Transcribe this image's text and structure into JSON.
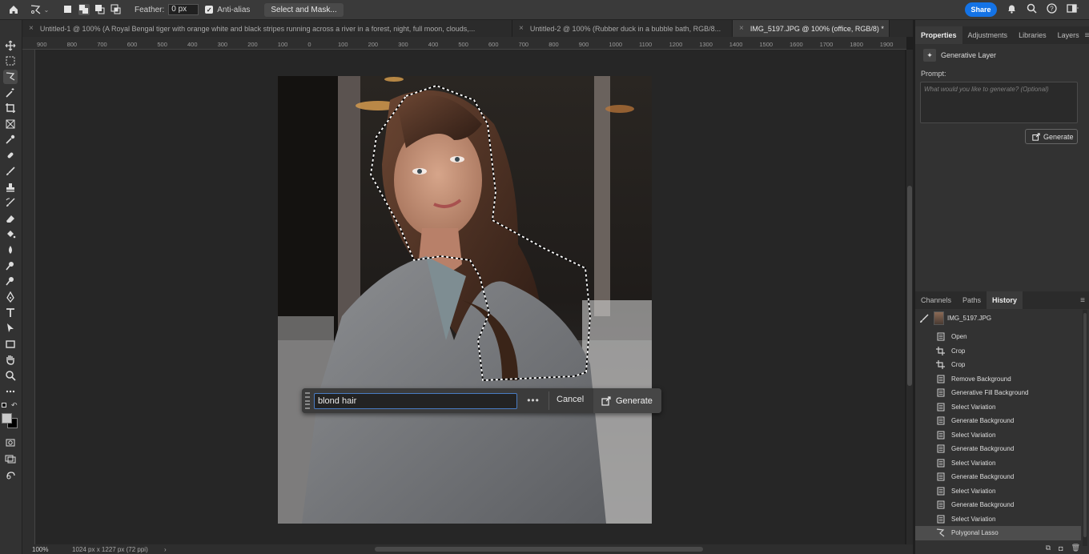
{
  "options": {
    "feather_label": "Feather:",
    "feather_value": "0 px",
    "antialias_label": "Anti-alias",
    "antialias_checked": true,
    "select_mask_label": "Select and Mask...",
    "share_label": "Share"
  },
  "tabs": [
    {
      "label": "Untitled-1 @ 100% (A Royal Bengal tiger with orange white and black stripes running across a river in a forest, night, full moon, clouds,...",
      "active": false
    },
    {
      "label": "Untitled-2 @ 100% (Rubber duck in a bubble bath, RGB/8...",
      "active": false
    },
    {
      "label": "IMG_5197.JPG @ 100% (office, RGB/8) *",
      "active": true
    }
  ],
  "ruler_top": [
    "900",
    "800",
    "700",
    "600",
    "500",
    "400",
    "300",
    "200",
    "100",
    "0",
    "100",
    "200",
    "300",
    "400",
    "500",
    "600",
    "700",
    "800",
    "900",
    "1000",
    "1100",
    "1200",
    "1300",
    "1400",
    "1500",
    "1600",
    "1700",
    "1800",
    "1900"
  ],
  "prompt_bar": {
    "value": "blond hair",
    "more": "•••",
    "cancel": "Cancel",
    "generate": "Generate"
  },
  "status": {
    "zoom": "100%",
    "dims": "1024 px x 1227 px (72 ppi)",
    "chevron": "›"
  },
  "panel": {
    "tabs": [
      "Properties",
      "Adjustments",
      "Libraries",
      "Layers"
    ],
    "active_tab": "Properties",
    "layer_kind": "Generative Layer",
    "prompt_label": "Prompt:",
    "prompt_placeholder": "What would you like to generate? (Optional)",
    "generate": "Generate"
  },
  "history": {
    "tabs": [
      "Channels",
      "Paths",
      "History"
    ],
    "active_tab": "History",
    "snapshot": "IMG_5197.JPG",
    "items": [
      {
        "label": "Open",
        "icon": "doc"
      },
      {
        "label": "Crop",
        "icon": "crop"
      },
      {
        "label": "Crop",
        "icon": "crop"
      },
      {
        "label": "Remove Background",
        "icon": "doc"
      },
      {
        "label": "Generative Fill Background",
        "icon": "doc"
      },
      {
        "label": "Select Variation",
        "icon": "doc"
      },
      {
        "label": "Generate Background",
        "icon": "doc"
      },
      {
        "label": "Select Variation",
        "icon": "doc"
      },
      {
        "label": "Generate Background",
        "icon": "doc"
      },
      {
        "label": "Select Variation",
        "icon": "doc"
      },
      {
        "label": "Generate Background",
        "icon": "doc"
      },
      {
        "label": "Select Variation",
        "icon": "doc"
      },
      {
        "label": "Generate Background",
        "icon": "doc"
      },
      {
        "label": "Select Variation",
        "icon": "doc"
      },
      {
        "label": "Polygonal Lasso",
        "icon": "lasso"
      }
    ],
    "selected_index": 14
  }
}
